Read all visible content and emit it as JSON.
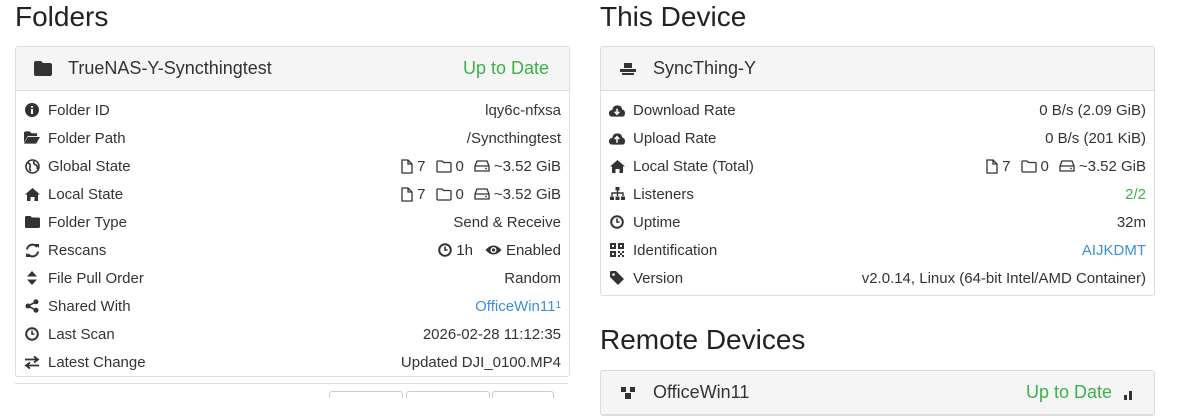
{
  "folders": {
    "section_title": "Folders",
    "folder": {
      "name": "TrueNAS-Y-Syncthingtest",
      "status": "Up to Date",
      "rows": {
        "folder_id": {
          "label": "Folder ID",
          "value": "lqy6c-nfxsa"
        },
        "folder_path": {
          "label": "Folder Path",
          "value": "/Syncthingtest"
        },
        "global_state": {
          "label": "Global State",
          "files": "7",
          "dirs": "0",
          "size": "~3.52 GiB"
        },
        "local_state": {
          "label": "Local State",
          "files": "7",
          "dirs": "0",
          "size": "~3.52 GiB"
        },
        "folder_type": {
          "label": "Folder Type",
          "value": "Send & Receive"
        },
        "rescans": {
          "label": "Rescans",
          "interval": "1h",
          "watch": "Enabled"
        },
        "file_pull_order": {
          "label": "File Pull Order",
          "value": "Random"
        },
        "shared_with": {
          "label": "Shared With",
          "value": "OfficeWin11",
          "count": "1"
        },
        "last_scan": {
          "label": "Last Scan",
          "value": "2026-02-28 11:12:35"
        },
        "latest_change": {
          "label": "Latest Change",
          "value": "Updated DJI_0100.MP4"
        }
      }
    }
  },
  "this_device": {
    "section_title": "This Device",
    "name": "SyncThing-Y",
    "rows": {
      "download_rate": {
        "label": "Download Rate",
        "value": "0 B/s (2.09 GiB)"
      },
      "upload_rate": {
        "label": "Upload Rate",
        "value": "0 B/s (201 KiB)"
      },
      "local_state_total": {
        "label": "Local State (Total)",
        "files": "7",
        "dirs": "0",
        "size": "~3.52 GiB"
      },
      "listeners": {
        "label": "Listeners",
        "value": "2/2"
      },
      "uptime": {
        "label": "Uptime",
        "value": "32m"
      },
      "identification": {
        "label": "Identification",
        "value": "AIJKDMT"
      },
      "version": {
        "label": "Version",
        "value": "v2.0.14, Linux (64-bit Intel/AMD Container)"
      }
    }
  },
  "remote_devices": {
    "section_title": "Remote Devices",
    "device": {
      "name": "OfficeWin11",
      "status": "Up to Date"
    }
  },
  "colors": {
    "accent_green": "#3cb149",
    "link_blue": "#3c8fd9",
    "panel_heading_bg": "#f5f5f5"
  }
}
